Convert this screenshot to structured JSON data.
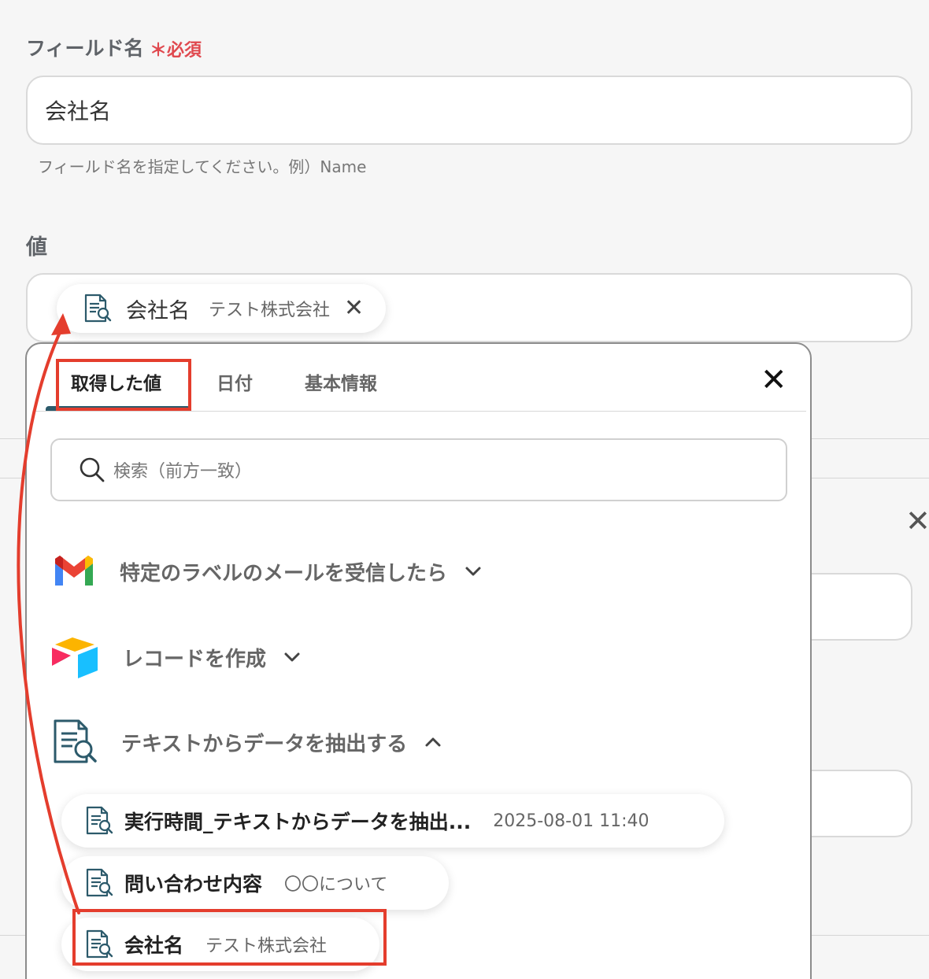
{
  "field_name": {
    "label": "フィールド名",
    "required_mark": "＊",
    "required_text": "必須",
    "value": "会社名",
    "hint": "フィールド名を指定してください。例）Name"
  },
  "value_field": {
    "label": "値",
    "token": {
      "name": "会社名",
      "value": "テスト株式会社",
      "remove": "✕"
    }
  },
  "popover": {
    "tabs": [
      "取得した値",
      "日付",
      "基本情報"
    ],
    "active_tab": "取得した値",
    "close": "✕",
    "search_placeholder": "検索（前方一致）",
    "sections": [
      {
        "title": "特定のラベルのメールを受信したら",
        "icon": "gmail-icon",
        "expanded": false
      },
      {
        "title": "レコードを作成",
        "icon": "airtable-icon",
        "expanded": false
      },
      {
        "title": "テキストからデータを抽出する",
        "icon": "text-extract-icon",
        "expanded": true
      }
    ],
    "items": [
      {
        "label": "実行時間_テキストからデータを抽出...",
        "value": "2025-08-01 11:40"
      },
      {
        "label": "問い合わせ内容",
        "value": "〇〇について"
      },
      {
        "label": "会社名",
        "value": "テスト株式会社"
      }
    ]
  },
  "colors": {
    "accent": "#2c5a6b",
    "annotation": "#e43d2d",
    "required": "#e0494f"
  }
}
